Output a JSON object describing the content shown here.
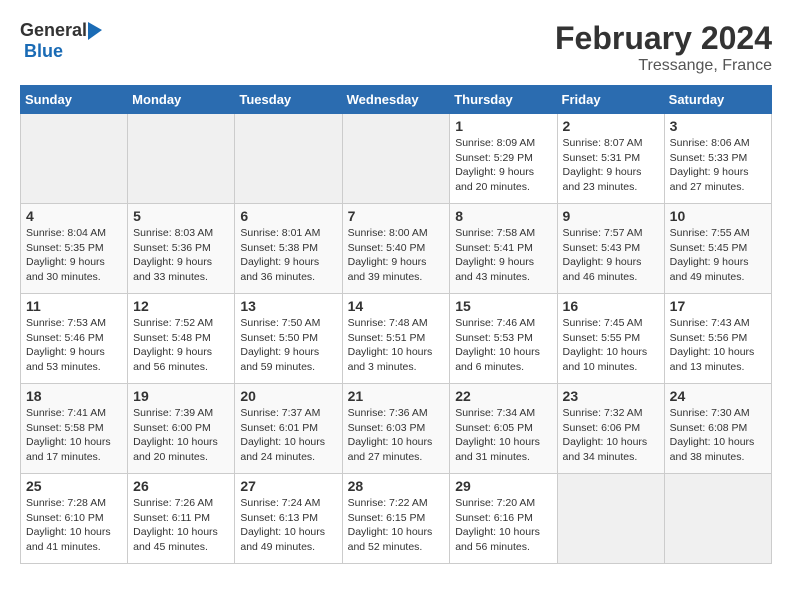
{
  "header": {
    "logo_general": "General",
    "logo_blue": "Blue",
    "month": "February 2024",
    "location": "Tressange, France"
  },
  "days_of_week": [
    "Sunday",
    "Monday",
    "Tuesday",
    "Wednesday",
    "Thursday",
    "Friday",
    "Saturday"
  ],
  "weeks": [
    [
      {
        "day": "",
        "info": ""
      },
      {
        "day": "",
        "info": ""
      },
      {
        "day": "",
        "info": ""
      },
      {
        "day": "",
        "info": ""
      },
      {
        "day": "1",
        "info": "Sunrise: 8:09 AM\nSunset: 5:29 PM\nDaylight: 9 hours\nand 20 minutes."
      },
      {
        "day": "2",
        "info": "Sunrise: 8:07 AM\nSunset: 5:31 PM\nDaylight: 9 hours\nand 23 minutes."
      },
      {
        "day": "3",
        "info": "Sunrise: 8:06 AM\nSunset: 5:33 PM\nDaylight: 9 hours\nand 27 minutes."
      }
    ],
    [
      {
        "day": "4",
        "info": "Sunrise: 8:04 AM\nSunset: 5:35 PM\nDaylight: 9 hours\nand 30 minutes."
      },
      {
        "day": "5",
        "info": "Sunrise: 8:03 AM\nSunset: 5:36 PM\nDaylight: 9 hours\nand 33 minutes."
      },
      {
        "day": "6",
        "info": "Sunrise: 8:01 AM\nSunset: 5:38 PM\nDaylight: 9 hours\nand 36 minutes."
      },
      {
        "day": "7",
        "info": "Sunrise: 8:00 AM\nSunset: 5:40 PM\nDaylight: 9 hours\nand 39 minutes."
      },
      {
        "day": "8",
        "info": "Sunrise: 7:58 AM\nSunset: 5:41 PM\nDaylight: 9 hours\nand 43 minutes."
      },
      {
        "day": "9",
        "info": "Sunrise: 7:57 AM\nSunset: 5:43 PM\nDaylight: 9 hours\nand 46 minutes."
      },
      {
        "day": "10",
        "info": "Sunrise: 7:55 AM\nSunset: 5:45 PM\nDaylight: 9 hours\nand 49 minutes."
      }
    ],
    [
      {
        "day": "11",
        "info": "Sunrise: 7:53 AM\nSunset: 5:46 PM\nDaylight: 9 hours\nand 53 minutes."
      },
      {
        "day": "12",
        "info": "Sunrise: 7:52 AM\nSunset: 5:48 PM\nDaylight: 9 hours\nand 56 minutes."
      },
      {
        "day": "13",
        "info": "Sunrise: 7:50 AM\nSunset: 5:50 PM\nDaylight: 9 hours\nand 59 minutes."
      },
      {
        "day": "14",
        "info": "Sunrise: 7:48 AM\nSunset: 5:51 PM\nDaylight: 10 hours\nand 3 minutes."
      },
      {
        "day": "15",
        "info": "Sunrise: 7:46 AM\nSunset: 5:53 PM\nDaylight: 10 hours\nand 6 minutes."
      },
      {
        "day": "16",
        "info": "Sunrise: 7:45 AM\nSunset: 5:55 PM\nDaylight: 10 hours\nand 10 minutes."
      },
      {
        "day": "17",
        "info": "Sunrise: 7:43 AM\nSunset: 5:56 PM\nDaylight: 10 hours\nand 13 minutes."
      }
    ],
    [
      {
        "day": "18",
        "info": "Sunrise: 7:41 AM\nSunset: 5:58 PM\nDaylight: 10 hours\nand 17 minutes."
      },
      {
        "day": "19",
        "info": "Sunrise: 7:39 AM\nSunset: 6:00 PM\nDaylight: 10 hours\nand 20 minutes."
      },
      {
        "day": "20",
        "info": "Sunrise: 7:37 AM\nSunset: 6:01 PM\nDaylight: 10 hours\nand 24 minutes."
      },
      {
        "day": "21",
        "info": "Sunrise: 7:36 AM\nSunset: 6:03 PM\nDaylight: 10 hours\nand 27 minutes."
      },
      {
        "day": "22",
        "info": "Sunrise: 7:34 AM\nSunset: 6:05 PM\nDaylight: 10 hours\nand 31 minutes."
      },
      {
        "day": "23",
        "info": "Sunrise: 7:32 AM\nSunset: 6:06 PM\nDaylight: 10 hours\nand 34 minutes."
      },
      {
        "day": "24",
        "info": "Sunrise: 7:30 AM\nSunset: 6:08 PM\nDaylight: 10 hours\nand 38 minutes."
      }
    ],
    [
      {
        "day": "25",
        "info": "Sunrise: 7:28 AM\nSunset: 6:10 PM\nDaylight: 10 hours\nand 41 minutes."
      },
      {
        "day": "26",
        "info": "Sunrise: 7:26 AM\nSunset: 6:11 PM\nDaylight: 10 hours\nand 45 minutes."
      },
      {
        "day": "27",
        "info": "Sunrise: 7:24 AM\nSunset: 6:13 PM\nDaylight: 10 hours\nand 49 minutes."
      },
      {
        "day": "28",
        "info": "Sunrise: 7:22 AM\nSunset: 6:15 PM\nDaylight: 10 hours\nand 52 minutes."
      },
      {
        "day": "29",
        "info": "Sunrise: 7:20 AM\nSunset: 6:16 PM\nDaylight: 10 hours\nand 56 minutes."
      },
      {
        "day": "",
        "info": ""
      },
      {
        "day": "",
        "info": ""
      }
    ]
  ]
}
